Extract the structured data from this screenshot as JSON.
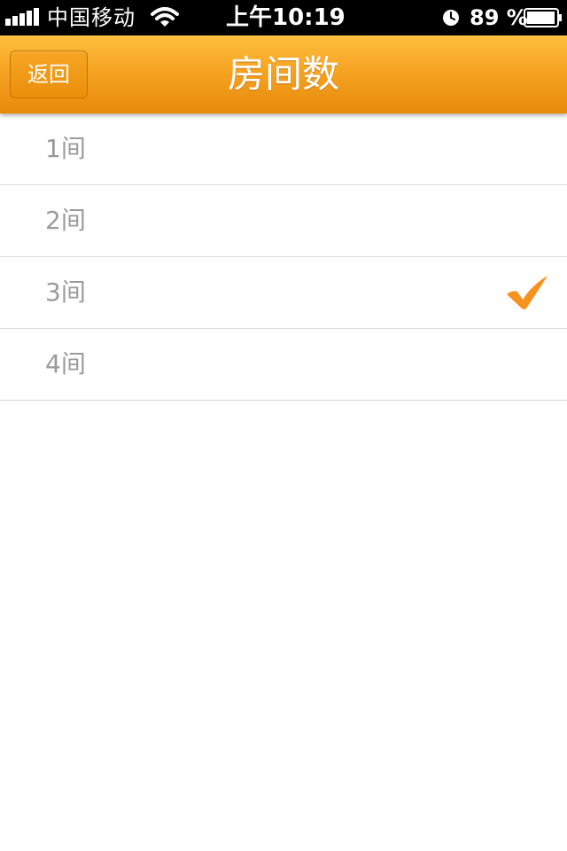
{
  "status_bar": {
    "carrier": "中国移动",
    "time": "上午10:19",
    "battery_percent": "89 %",
    "signal_icon": "signal-bars-icon",
    "wifi_icon": "wifi-icon",
    "alarm_icon": "clock-icon",
    "battery_icon": "battery-icon"
  },
  "nav": {
    "back_label": "返回",
    "title": "房间数",
    "bar_color": "#f6a322"
  },
  "options": [
    {
      "label": "1间",
      "selected": false
    },
    {
      "label": "2间",
      "selected": false
    },
    {
      "label": "3间",
      "selected": true
    },
    {
      "label": "4间",
      "selected": false
    }
  ],
  "check_icon": "checkmark-icon",
  "check_color": "#f7921e"
}
